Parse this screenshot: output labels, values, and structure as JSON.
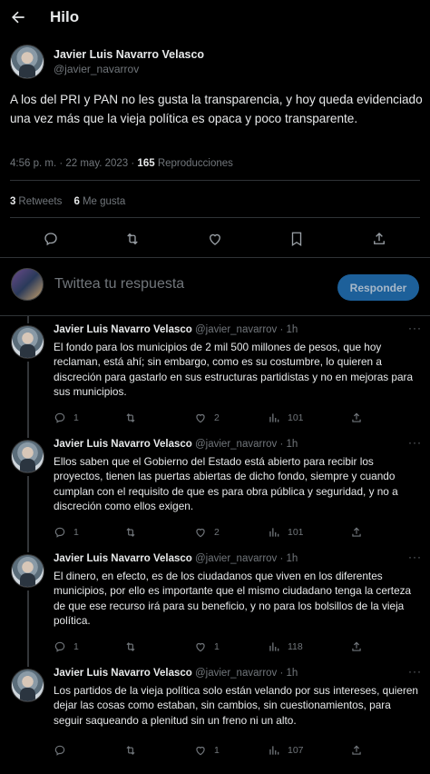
{
  "header": {
    "title": "Hilo"
  },
  "tweet": {
    "author_name": "Javier Luis Navarro Velasco",
    "author_handle": "@javier_navarrov",
    "text": "A los del PRI y PAN no les gusta la transparencia, y hoy queda evidenciado una vez más que la vieja política es opaca y poco transparente.",
    "time": "4:56 p. m. · 22 may. 2023 ·",
    "views_count": "165",
    "views_label": "Reproducciones",
    "retweets_count": "3",
    "retweets_label": "Retweets",
    "likes_count": "6",
    "likes_label": "Me gusta"
  },
  "reply_box": {
    "placeholder": "Twittea tu respuesta",
    "button_label": "Responder"
  },
  "replies": [
    {
      "name": "Javier Luis Navarro Velasco",
      "handle": "@javier_navarrov · 1h",
      "text": "El fondo para los municipios de 2 mil 500 millones de pesos, que hoy reclaman, está ahí; sin embargo, como es su costumbre, lo quieren a discreción para gastarlo en sus estructuras partidistas y no en mejoras para sus municipios.",
      "replies": "1",
      "retweets": "",
      "likes": "2",
      "views": "101"
    },
    {
      "name": "Javier Luis Navarro Velasco",
      "handle": "@javier_navarrov · 1h",
      "text": "Ellos saben que el Gobierno del Estado está abierto para recibir los proyectos, tienen las puertas abiertas de dicho fondo, siempre y cuando cumplan con el requisito de que es para obra pública y seguridad, y no a discreción como ellos exigen.",
      "replies": "1",
      "retweets": "",
      "likes": "2",
      "views": "101"
    },
    {
      "name": "Javier Luis Navarro Velasco",
      "handle": "@javier_navarrov · 1h",
      "text": "El dinero, en efecto, es de los ciudadanos que viven en los diferentes municipios, por ello es importante que el mismo ciudadano tenga la certeza de que ese recurso irá para su beneficio, y no para los bolsillos de la vieja política.",
      "replies": "1",
      "retweets": "",
      "likes": "1",
      "views": "118"
    },
    {
      "name": "Javier Luis Navarro Velasco",
      "handle": "@javier_navarrov · 1h",
      "text": "Los partidos de la vieja política solo están velando por sus intereses, quieren dejar las cosas como estaban, sin cambios, sin cuestionamientos, para seguir saqueando a plenitud sin un freno ni un alto.",
      "replies": "",
      "retweets": "",
      "likes": "1",
      "views": "107"
    }
  ]
}
